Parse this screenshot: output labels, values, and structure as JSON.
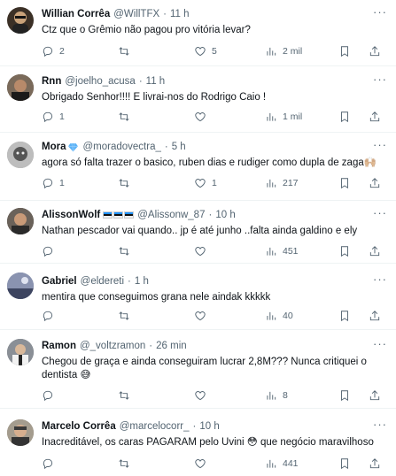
{
  "tweets": [
    {
      "name": "Willian Corrêa",
      "handle": "@WillTFX",
      "time": "11 h",
      "text": "Ctz que o Grêmio não pagou pro vitória levar?",
      "replies": "2",
      "retweets": "",
      "likes": "5",
      "views": "2 mil",
      "avatar_color": "#3b3026"
    },
    {
      "name": "Rnn",
      "handle": "@joelho_acusa",
      "time": "11 h",
      "text": "Obrigado Senhor!!!! E livrai-nos do Rodrigo Caio !",
      "replies": "1",
      "retweets": "",
      "likes": "",
      "views": "1 mil",
      "avatar_color": "#5a5046"
    },
    {
      "name": "Mora",
      "handle": "@moradovectra_",
      "time": "5 h",
      "text": "agora só falta trazer o basico, ruben dias e rudiger como dupla de zaga🙌🏼",
      "replies": "1",
      "retweets": "",
      "likes": "1",
      "views": "217",
      "avatar_color": "#9a9a9a"
    },
    {
      "name": "AlissonWolf",
      "handle": "@Alissonw_87",
      "time": "10 h",
      "text": "Nathan pescador vai quando.. jp é até junho ..falta ainda galdino e ely",
      "replies": "",
      "retweets": "",
      "likes": "",
      "views": "451",
      "avatar_color": "#4a4440"
    },
    {
      "name": "Gabriel",
      "handle": "@eldereti",
      "time": "1 h",
      "text": "mentira que conseguimos grana nele aindak kkkkk",
      "replies": "",
      "retweets": "",
      "likes": "",
      "views": "40",
      "avatar_color": "#6a7590"
    },
    {
      "name": "Ramon",
      "handle": "@_voltzramon",
      "time": "26 min",
      "text": "Chegou de graça  e ainda conseguiram lucrar 2,8M???  Nunca  critiquei o dentista 😅",
      "replies": "",
      "retweets": "",
      "likes": "",
      "views": "8",
      "avatar_color": "#6b6f74"
    },
    {
      "name": "Marcelo Corrêa",
      "handle": "@marcelocorr_",
      "time": "10 h",
      "text": "Inacreditável, os caras PAGARAM pelo Uvini 😳 que negócio maravilhoso",
      "replies": "",
      "retweets": "",
      "likes": "",
      "views": "441",
      "avatar_color": "#8a8276"
    }
  ],
  "colors": {
    "text_primary": "#0f1419",
    "text_secondary": "#536471",
    "divider": "#eff3f4",
    "verified": "#1d9bf0"
  },
  "icons": [
    "reply-icon",
    "retweet-icon",
    "like-icon",
    "views-icon",
    "bookmark-icon",
    "share-icon",
    "more-icon"
  ]
}
